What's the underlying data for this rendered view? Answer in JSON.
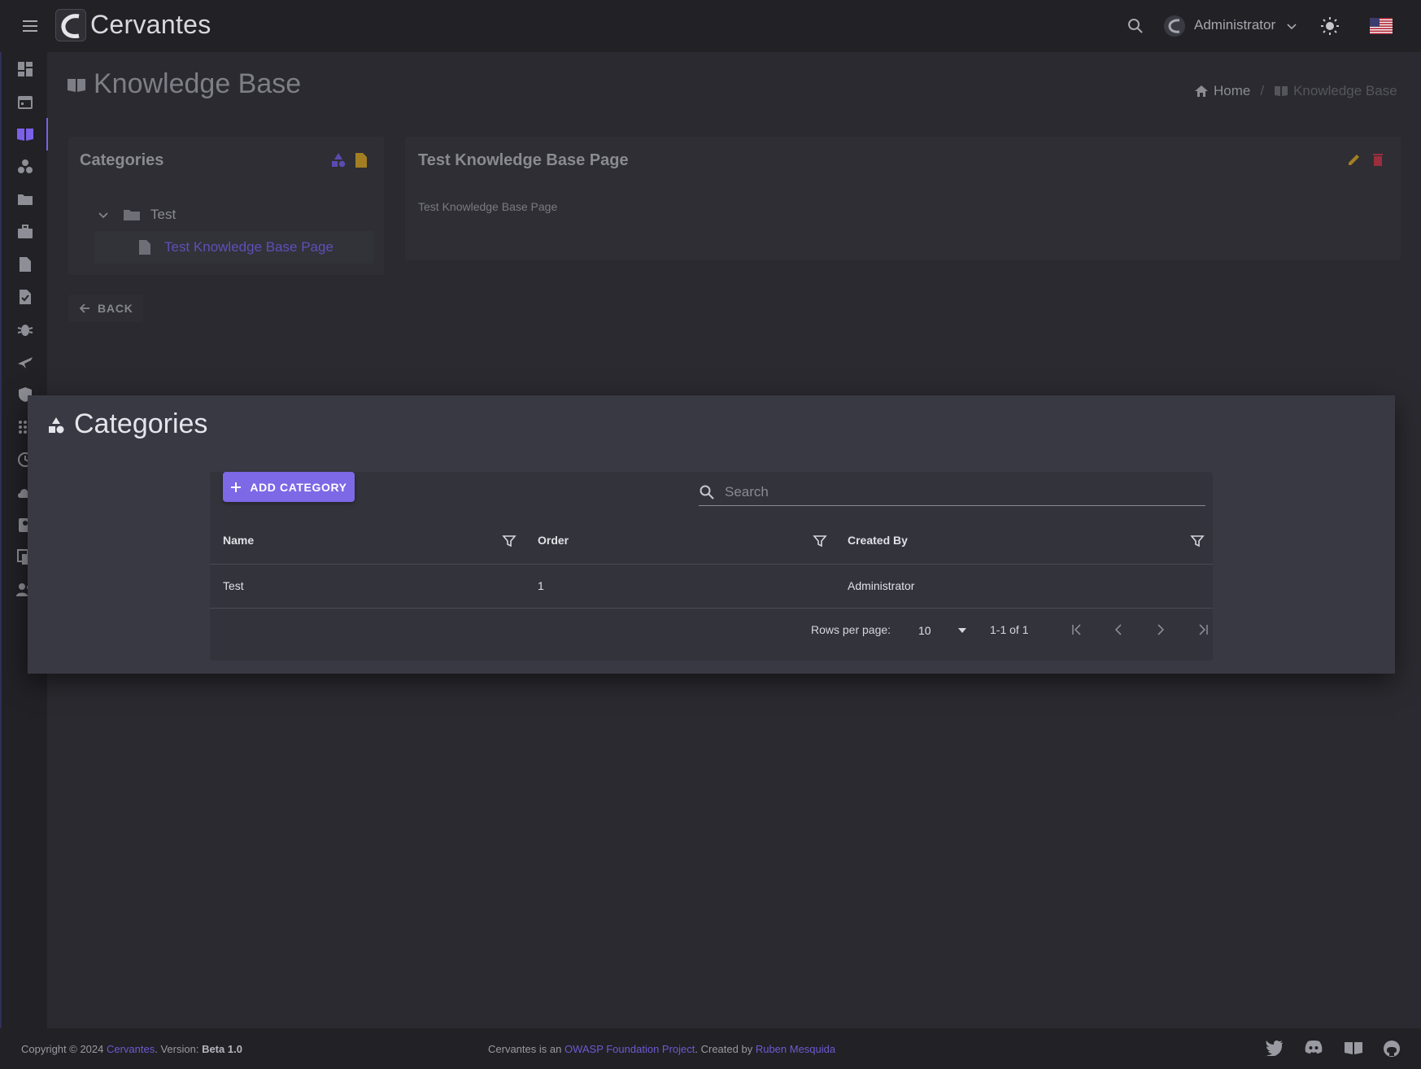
{
  "app": {
    "brand": "Cervantes"
  },
  "header": {
    "user_name": "Administrator"
  },
  "page": {
    "title": "Knowledge Base",
    "breadcrumb": {
      "home": "Home",
      "current": "Knowledge Base"
    }
  },
  "categories_panel": {
    "title": "Categories",
    "tree": {
      "folder": "Test",
      "page": "Test Knowledge Base Page"
    }
  },
  "kb_page": {
    "title": "Test Knowledge Base Page",
    "content": "Test Knowledge Base Page"
  },
  "back_label": "BACK",
  "dialog": {
    "title": "Categories",
    "add_label": "ADD CATEGORY",
    "search_placeholder": "Search",
    "columns": [
      "Name",
      "Order",
      "Created By"
    ],
    "rows": [
      {
        "name": "Test",
        "order": "1",
        "created_by": "Administrator"
      }
    ],
    "pagination": {
      "rows_label": "Rows per page:",
      "rows_value": "10",
      "range": "1-1 of 1"
    }
  },
  "footer": {
    "copyright": "Copyright © 2024",
    "brand_link": "Cervantes",
    "version_label": ". Version:",
    "version": "Beta 1.0",
    "project_prefix": "Cervantes is an",
    "project_link": "OWASP Foundation Project",
    "created_prefix": ". Created by",
    "author": "Ruben Mesquida"
  },
  "colors": {
    "accent": "#7d68e6",
    "edit": "#c9a227",
    "delete": "#c0394b",
    "background": "#2a2a30"
  },
  "icons": [
    "menu-icon",
    "search-icon",
    "chevron-down-icon",
    "sun-icon",
    "flag-us-icon",
    "book-icon",
    "home-icon",
    "folder-icon",
    "file-icon",
    "shapes-icon",
    "pencil-icon",
    "trash-icon",
    "arrow-left-icon",
    "plus-icon",
    "filter-icon",
    "first-page-icon",
    "prev-page-icon",
    "next-page-icon",
    "last-page-icon",
    "twitter-icon",
    "discord-icon",
    "github-icon"
  ]
}
